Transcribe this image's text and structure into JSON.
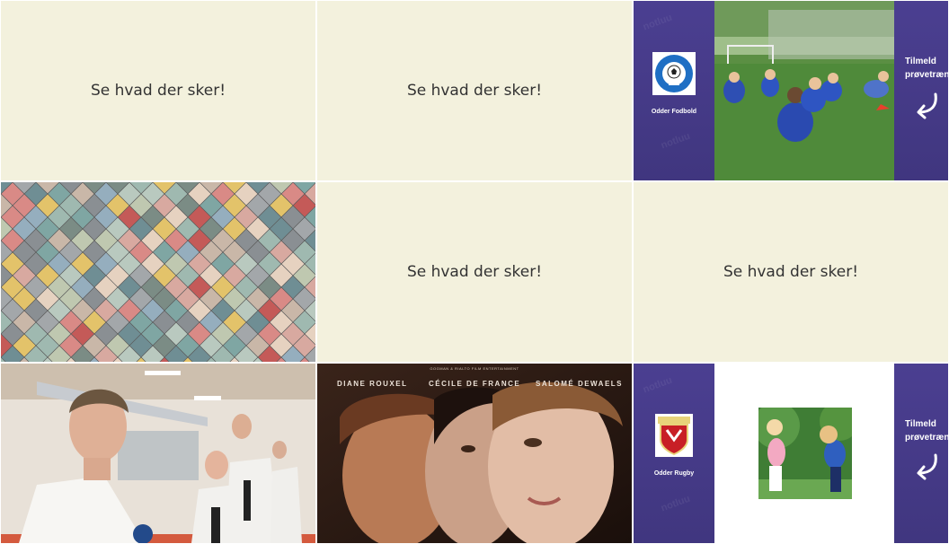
{
  "tiles": {
    "text_1": "Se hvad der sker!",
    "text_2": "Se hvad der sker!",
    "text_3": "Se hvad der sker!",
    "text_4": "Se hvad der sker!"
  },
  "football": {
    "club_name": "Odder Fodbold",
    "logo_text": "ODDER IGF FODBOLD",
    "cta_line1": "Tilmeld",
    "cta_line2": "prøvetræn"
  },
  "rugby": {
    "club_name": "Odder Rugby",
    "cta_line1": "Tilmeld",
    "cta_line2": "prøvetræn"
  },
  "movie": {
    "presenter": "GOGMAN & RIALTO FILM ENTERTAINMENT",
    "cast": [
      "DIANE ROUXEL",
      "CÉCILE DE FRANCE",
      "SALOMÉ DEWAELS"
    ]
  },
  "colors": {
    "cream": "#f3f1dd",
    "club_purple": "#4b3f91",
    "grass": "#4f8a3a"
  },
  "icons": [
    "football-logo-icon",
    "rugby-shield-icon",
    "curved-arrow-icon"
  ]
}
